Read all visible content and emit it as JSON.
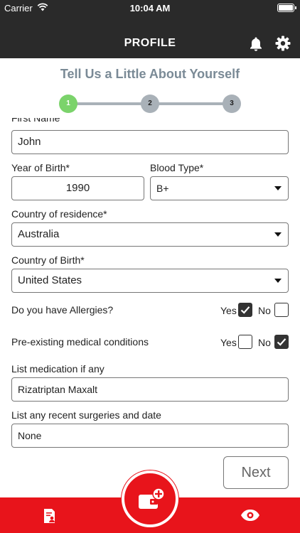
{
  "status_bar": {
    "carrier": "Carrier",
    "time": "10:04 AM"
  },
  "nav": {
    "title": "PROFILE",
    "icons": [
      "bell-icon",
      "gear-icon"
    ]
  },
  "heading": "Tell Us a Little About Yourself",
  "stepper": {
    "steps": [
      "1",
      "2",
      "3"
    ],
    "current": 1
  },
  "form": {
    "first_name": {
      "label": "First Name",
      "value": "John"
    },
    "year_of_birth": {
      "label": "Year of Birth*",
      "value": "1990"
    },
    "blood_type": {
      "label": "Blood Type*",
      "value": "B+"
    },
    "country_residence": {
      "label": "Country of residence*",
      "value": "Australia"
    },
    "country_birth": {
      "label": "Country of Birth*",
      "value": "United States"
    },
    "allergies": {
      "label": "Do you have Allergies?",
      "yes": "Yes",
      "no": "No",
      "answer": "yes"
    },
    "conditions": {
      "label": "Pre-existing medical  conditions",
      "yes": "Yes",
      "no": "No",
      "answer": "no"
    },
    "medication": {
      "label": "List medication if any",
      "value": "Rizatriptan Maxalt"
    },
    "surgeries": {
      "label": "List any recent surgeries and date",
      "value": "None"
    },
    "next_label": "Next"
  },
  "tab_bar": {
    "icons": [
      "document-user-icon",
      "add-wallet-icon",
      "eye-icon"
    ]
  },
  "colors": {
    "accent": "#e8141b",
    "header": "#2a2a2a",
    "step_active": "#7bd36b",
    "step_inactive": "#a9b1b8",
    "heading": "#7a8a96"
  }
}
